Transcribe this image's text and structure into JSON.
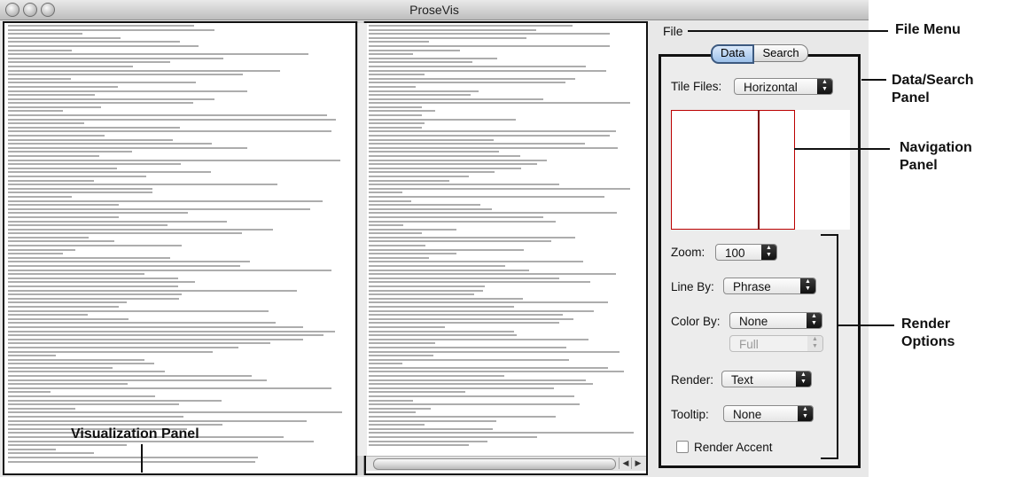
{
  "window": {
    "title": "ProseVis"
  },
  "menu": {
    "file": "File"
  },
  "tabs": [
    {
      "label": "Data"
    },
    {
      "label": "Search"
    }
  ],
  "options": {
    "tile_files": {
      "label": "Tile Files:",
      "value": "Horizontal"
    },
    "zoom": {
      "label": "Zoom:",
      "value": "100"
    },
    "line_by": {
      "label": "Line By:",
      "value": "Phrase"
    },
    "color_by": {
      "label": "Color By:",
      "value": "None",
      "sub_value": "Full"
    },
    "render": {
      "label": "Render:",
      "value": "Text"
    },
    "tooltip": {
      "label": "Tooltip:",
      "value": "None"
    },
    "render_accent": {
      "label": "Render Accent",
      "checked": false
    }
  },
  "annotations": {
    "file_menu": "File Menu",
    "data_search_panel": "Data/Search Panel",
    "navigation_panel": "Navigation Panel",
    "render_options": "Render Options",
    "visualization_panel": "Visualization Panel"
  },
  "colors": {
    "nav_frame": "#bb0000",
    "nav_divider": "#7a0000",
    "active_tab": "#9cc0ea"
  }
}
